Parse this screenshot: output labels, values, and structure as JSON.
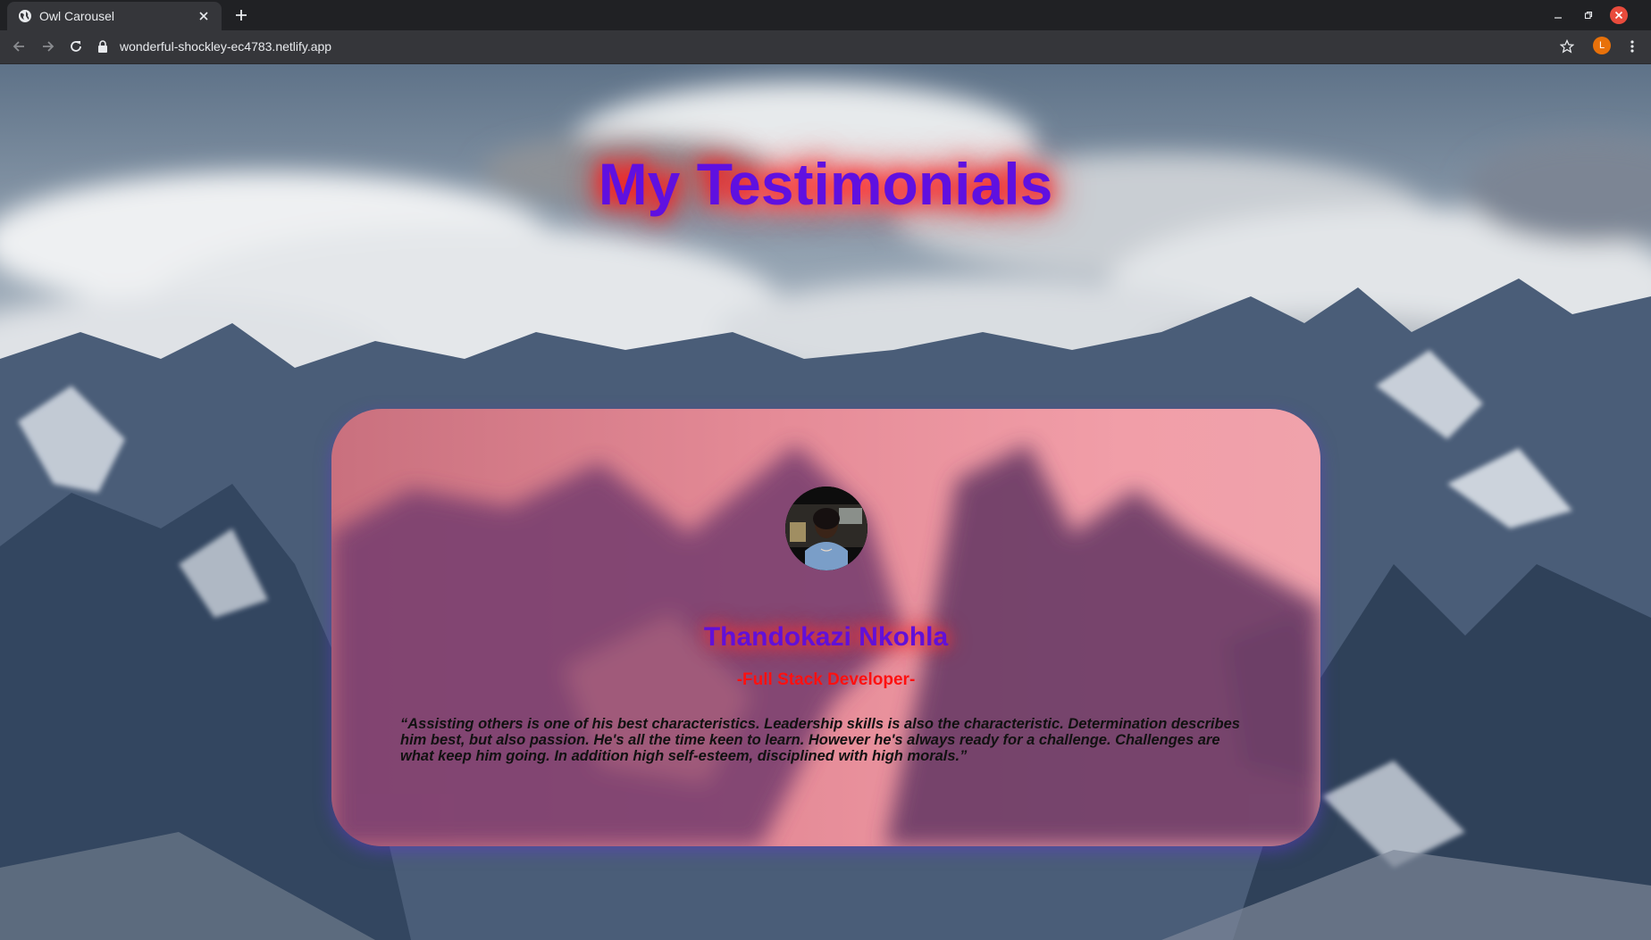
{
  "browser": {
    "tab_title": "Owl Carousel",
    "url": "wonderful-shockley-ec4783.netlify.app",
    "profile_initial": "L"
  },
  "page": {
    "title": "My Testimonials",
    "testimonial": {
      "name": "Thandokazi Nkohla",
      "role": "-Full Stack Developer-",
      "quote": "“Assisting others is one of his best characteristics. Leadership skills is also the characteristic. Determination describes him best, but also passion. He's all the time keen to learn. However he's always ready for a challenge. Challenges are what keep him going. In addition high self-esteem, disciplined with high morals.”"
    }
  },
  "colors": {
    "title": "#5f10e0",
    "title_glow": "#ff1a1a",
    "name": "#6110d8",
    "role": "#ff1010",
    "card_pink": "#f0a0aa",
    "card_purple": "#6b3a6a",
    "avatar": "#e8710a"
  },
  "icons": {
    "favicon": "globe-icon",
    "tab_close": "close-icon",
    "new_tab": "plus-icon",
    "back": "arrow-left-icon",
    "forward": "arrow-right-icon",
    "reload": "reload-icon",
    "lock": "lock-icon",
    "bookmark": "star-icon",
    "menu": "kebab-menu-icon"
  }
}
